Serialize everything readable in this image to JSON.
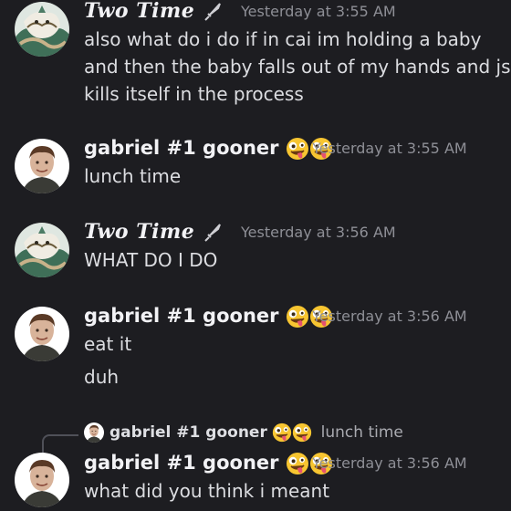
{
  "messages": [
    {
      "author": "Two Time",
      "timestamp": "Yesterday at 3:55 AM",
      "lines": [
        "also what do i do if in cai im holding a baby",
        "and then the baby falls out of my hands and js",
        "kills itself in the process"
      ]
    },
    {
      "author": "gabriel #1 gooner",
      "timestamp": "Yesterday at 3:55 AM",
      "lines": [
        "lunch time"
      ]
    },
    {
      "author": "Two Time",
      "timestamp": "Yesterday at 3:56 AM",
      "lines": [
        "WHAT DO I DO"
      ]
    },
    {
      "author": "gabriel #1 gooner",
      "timestamp": "Yesterday at 3:56 AM",
      "lines": [
        "eat it",
        "duh"
      ]
    },
    {
      "author": "gabriel #1 gooner",
      "timestamp": "Yesterday at 3:56 AM",
      "reply": {
        "author": "gabriel #1 gooner",
        "text": "lunch time"
      },
      "lines": [
        "what did you think i meant"
      ]
    }
  ],
  "icons": {
    "two_time_badge": "dagger-icon",
    "gabriel_badge": "zany-face-emoji"
  },
  "colors": {
    "background": "#1d1d21",
    "username": "#f2f2f5",
    "timestamp": "#8e8f96",
    "message_text": "#dcdde1"
  }
}
